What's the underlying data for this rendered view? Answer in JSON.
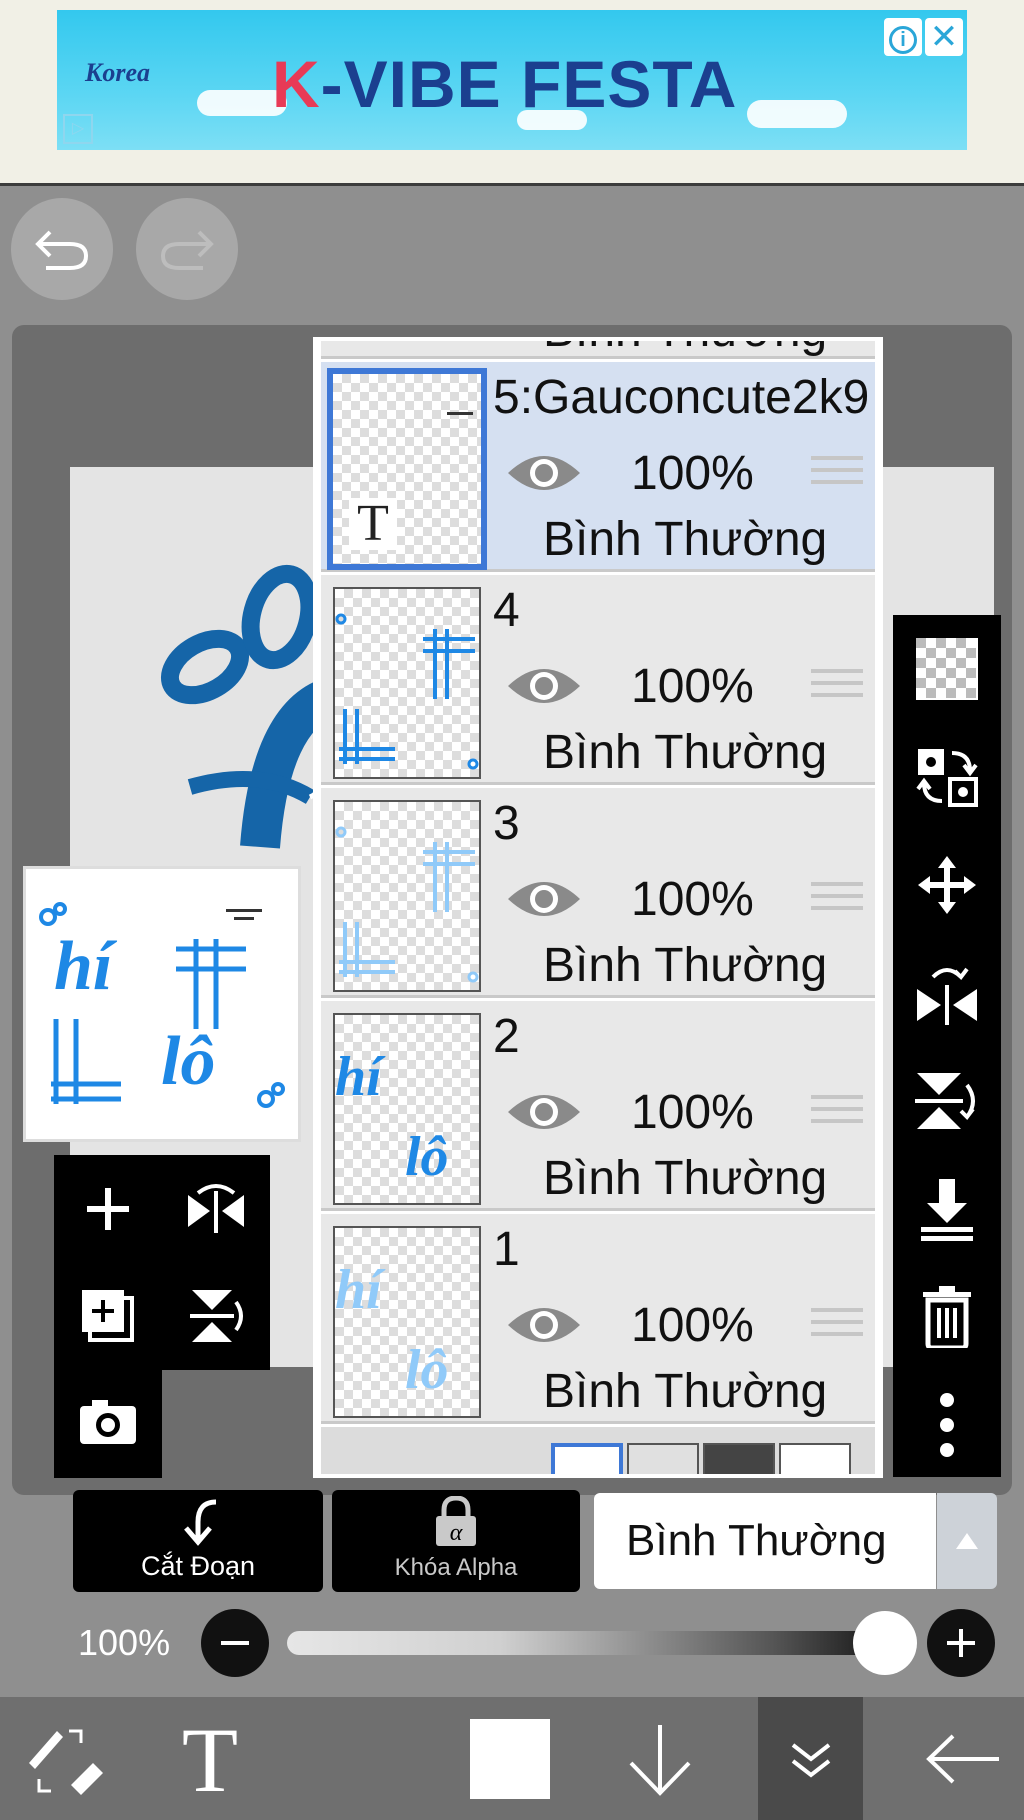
{
  "ad": {
    "title_k": "K",
    "title_rest": "-VIBE FESTA",
    "brand": "Korea",
    "info_icon": "info-icon",
    "close_icon": "close-icon"
  },
  "toolbar_top": {
    "undo_icon": "undo-icon",
    "redo_icon": "redo-icon"
  },
  "layers": [
    {
      "name": "5:Gauconcute2k9",
      "opacity": "100%",
      "blend": "Bình Thường",
      "selected": true,
      "text_badge": "T"
    },
    {
      "name": "4",
      "opacity": "100%",
      "blend": "Bình Thường",
      "selected": false
    },
    {
      "name": "3",
      "opacity": "100%",
      "blend": "Bình Thường",
      "selected": false
    },
    {
      "name": "2",
      "opacity": "100%",
      "blend": "Bình Thường",
      "selected": false
    },
    {
      "name": "1",
      "opacity": "100%",
      "blend": "Bình Thường",
      "selected": false
    }
  ],
  "partial_top_layer_blend": "Bình Thường",
  "bottom_controls": {
    "clipping_label": "Cắt Đoạn",
    "alpha_lock_label": "Khóa Alpha",
    "blend_mode": "Bình Thường",
    "opacity_text": "100%",
    "opacity_value": 1.0
  },
  "artwork": {
    "word1": "hí",
    "word2": "lô"
  },
  "colors": {
    "accent_blue": "#3e78d6",
    "art_blue": "#1e88e5",
    "art_light_blue": "#90caf9"
  }
}
